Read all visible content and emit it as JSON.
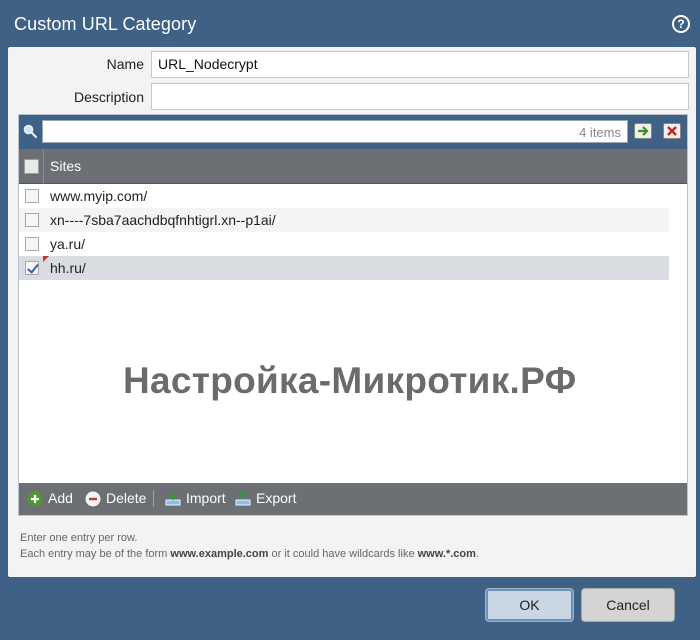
{
  "dialog": {
    "title": "Custom URL Category",
    "help_icon": "question-circle-icon"
  },
  "form": {
    "name_label": "Name",
    "name_value": "URL_Nodecrypt",
    "description_label": "Description",
    "description_value": ""
  },
  "grid": {
    "search_placeholder": "",
    "items_count": "4 items",
    "apply_icon": "arrow-right-icon",
    "clear_icon": "x-icon",
    "column_header": "Sites",
    "rows": [
      {
        "site": "www.myip.com/",
        "checked": false
      },
      {
        "site": "xn----7sba7aachdbqfnhtigrl.xn--p1ai/",
        "checked": false
      },
      {
        "site": "ya.ru/",
        "checked": false
      },
      {
        "site": "hh.ru/",
        "checked": true
      }
    ]
  },
  "watermark": "Настройка-Микротик.РФ",
  "toolbar": {
    "add_label": "Add",
    "delete_label": "Delete",
    "import_label": "Import",
    "export_label": "Export"
  },
  "hints": {
    "line1": "Enter one entry per row.",
    "line2_prefix": "Each entry may be of the form ",
    "line2_example": "www.example.com",
    "line2_middle": " or it could have wildcards like ",
    "line2_wildcard": "www.*.com",
    "line2_suffix": "."
  },
  "footer": {
    "ok_label": "OK",
    "cancel_label": "Cancel"
  },
  "colors": {
    "chrome": "#3f6185",
    "header_gray": "#6c6f73",
    "body_bg": "#f3f3f3"
  }
}
